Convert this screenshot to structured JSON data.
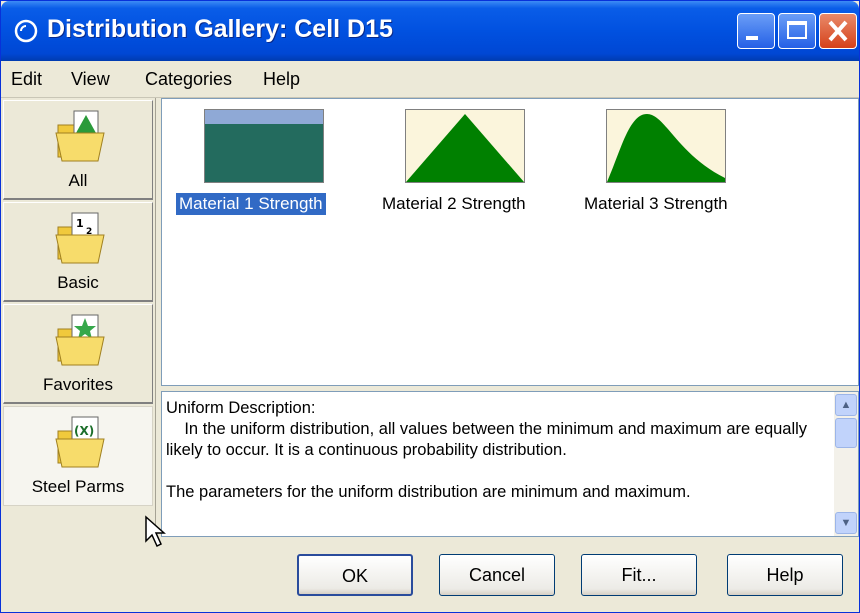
{
  "window": {
    "title": "Distribution Gallery: Cell D15"
  },
  "menu": [
    "Edit",
    "View",
    "Categories",
    "Help"
  ],
  "categories": [
    {
      "label": "All",
      "icon": "folder-chart-icon"
    },
    {
      "label": "Basic",
      "icon": "folder-numbers-icon"
    },
    {
      "label": "Favorites",
      "icon": "folder-star-icon"
    },
    {
      "label": "Steel Parms",
      "icon": "folder-excel-icon",
      "selected": true
    }
  ],
  "gallery": [
    {
      "label": "Material 1 Strength",
      "shape": "uniform",
      "selected": true
    },
    {
      "label": "Material 2 Strength",
      "shape": "triangular"
    },
    {
      "label": "Material 3 Strength",
      "shape": "lognormal"
    }
  ],
  "description": {
    "heading": "Uniform Description:",
    "body": "    In the uniform distribution, all values between the minimum and maximum are equally likely to occur. It is a continuous probability distribution.\n\nThe parameters for the uniform distribution are minimum and maximum."
  },
  "buttons": {
    "ok": "OK",
    "cancel": "Cancel",
    "fit": "Fit...",
    "help": "Help"
  },
  "colors": {
    "titlebar": "#0151e0",
    "selection": "#316ac5",
    "distribution_fill": "#008000",
    "uniform_fill": "#236b5e"
  }
}
